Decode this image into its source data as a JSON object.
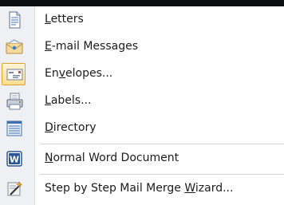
{
  "menu": {
    "items": [
      {
        "pre": "",
        "key": "L",
        "post": "etters",
        "icon": "letter-document-icon"
      },
      {
        "pre": "",
        "key": "E",
        "post": "-mail Messages",
        "icon": "email-envelope-icon"
      },
      {
        "pre": "En",
        "key": "v",
        "post": "elopes...",
        "icon": "envelope-icon"
      },
      {
        "pre": "",
        "key": "L",
        "post": "abels...",
        "icon": "labels-printer-icon"
      },
      {
        "pre": "",
        "key": "D",
        "post": "irectory",
        "icon": "directory-list-icon"
      },
      {
        "pre": "",
        "key": "N",
        "post": "ormal Word Document",
        "icon": "word-document-icon"
      },
      {
        "pre": "Step by Step Mail Merge ",
        "key": "W",
        "post": "izard...",
        "icon": "wizard-wand-icon"
      }
    ],
    "selected_index": 2
  },
  "colors": {
    "gutter": "#eef0f4",
    "highlight_border": "#e5a032",
    "word_blue": "#2b5797"
  }
}
